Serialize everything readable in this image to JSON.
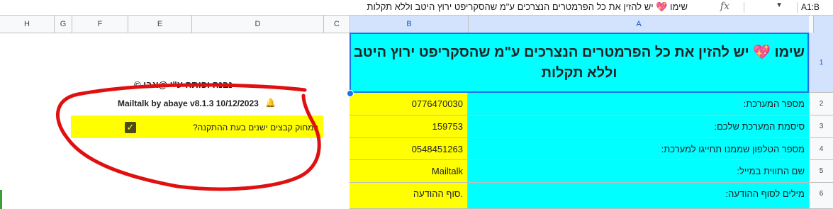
{
  "formula_bar": {
    "name_box": "A1:B",
    "fx_label": "fx",
    "formula": "שימו 💖 יש להזין את כל הפרמטרים הנצרכים ע\"מ שהסקריפט ירוץ היטב וללא תקלות"
  },
  "columns": [
    "H",
    "G",
    "F",
    "E",
    "D",
    "C",
    "B",
    "A"
  ],
  "panel": {
    "heading": "© נבנה ופותח ע\"י @אבי",
    "version": "Mailtalk by abaye v8.1.3 10/12/2023",
    "bell_icon": "bell-icon",
    "delete_old_files_label": "למחוק קבצים ישנים בעת ההתקנה?",
    "delete_old_files_checked": true
  },
  "sheet": {
    "header": "שימו 💖 יש להזין את כל הפרמטרים הנצרכים ע\"מ שהסקריפט ירוץ היטב וללא תקלות",
    "rows": [
      {
        "num": "2",
        "label": "מספר המערכת:",
        "value": "0776470030"
      },
      {
        "num": "3",
        "label": "סיסמת המערכת שלכם:",
        "value": "159753"
      },
      {
        "num": "4",
        "label": "מספר הטלפון שממנו תחייגו למערכת:",
        "value": "0548451263"
      },
      {
        "num": "5",
        "label": "שם התווית במייל:",
        "value": "Mailtalk"
      },
      {
        "num": "6",
        "label": "מילים לסוף ההודעה:",
        "value": "סוף ההודעה."
      }
    ],
    "header_row_num": "1"
  },
  "colors": {
    "yellow": "#ffff00",
    "cyan": "#00ffff",
    "annotation_red": "#e01010",
    "selection_blue": "#1a73e8"
  }
}
